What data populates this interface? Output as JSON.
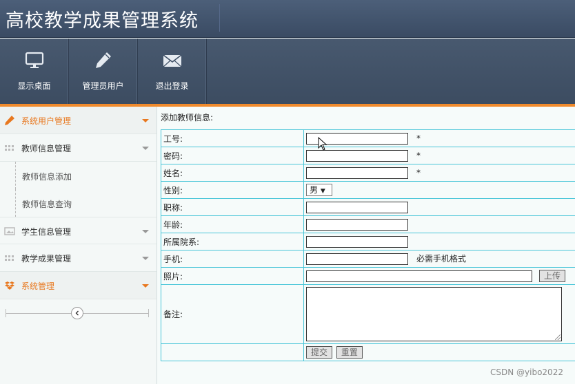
{
  "app": {
    "title": "高校教学成果管理系统"
  },
  "toolbar": [
    {
      "label": "显示桌面",
      "icon": "monitor-icon"
    },
    {
      "label": "管理员用户",
      "icon": "pencil-icon"
    },
    {
      "label": "退出登录",
      "icon": "envelope-icon"
    }
  ],
  "sidebar": {
    "items": [
      {
        "label": "系统用户管理",
        "icon": "pencil-icon",
        "active": true
      },
      {
        "label": "教师信息管理",
        "icon": "grid-icon"
      },
      {
        "label": "学生信息管理",
        "icon": "image-icon"
      },
      {
        "label": "教学成果管理",
        "icon": "grid-icon"
      },
      {
        "label": "系统管理",
        "icon": "dropbox-icon",
        "active": true
      }
    ],
    "subitems": [
      {
        "label": "教师信息添加"
      },
      {
        "label": "教师信息查询"
      }
    ]
  },
  "form": {
    "title": "添加教师信息:",
    "fields": {
      "id": {
        "label": "工号:",
        "required": "*"
      },
      "password": {
        "label": "密码:",
        "required": "*"
      },
      "name": {
        "label": "姓名:",
        "required": "*"
      },
      "gender": {
        "label": "性别:",
        "value": "男",
        "arrow": "▼"
      },
      "title": {
        "label": "职称:"
      },
      "age": {
        "label": "年龄:"
      },
      "department": {
        "label": "所属院系:"
      },
      "phone": {
        "label": "手机:",
        "hint": "必需手机格式"
      },
      "photo": {
        "label": "照片:",
        "upload": "上传"
      },
      "notes": {
        "label": "备注:"
      }
    },
    "submit": "提交",
    "reset": "重置"
  },
  "colors": {
    "accent": "#f08a2c",
    "header": "#3d4e65",
    "border": "#47c5d8"
  },
  "watermark": "CSDN @yibo2022"
}
